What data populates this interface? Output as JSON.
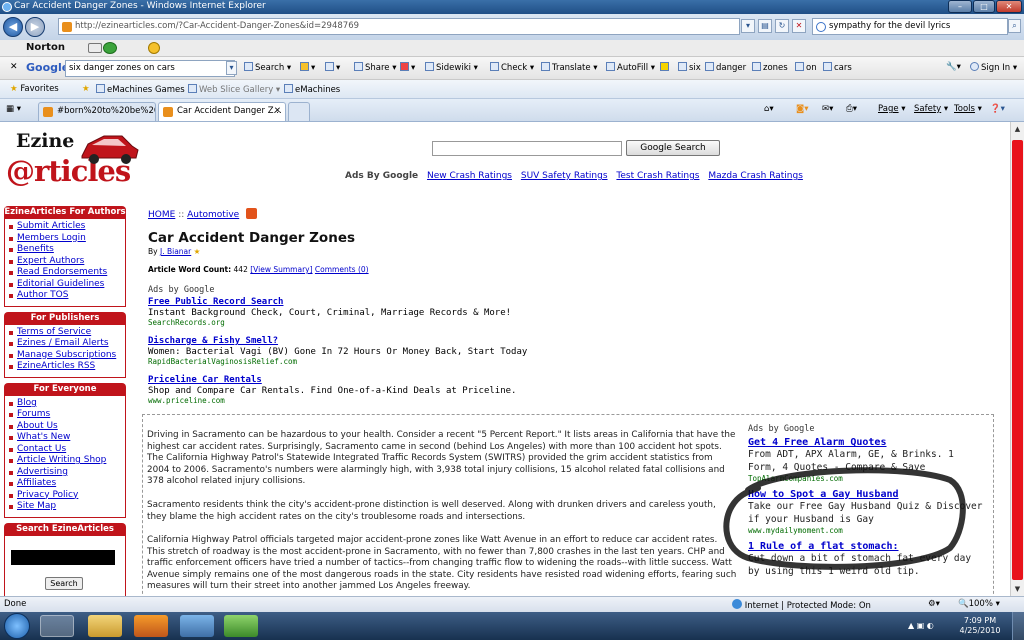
{
  "window": {
    "title": "Car Accident Danger Zones - Windows Internet Explorer"
  },
  "address_bar": {
    "url": "http://ezinearticles.com/?Car-Accident-Danger-Zones&id=2948769",
    "search_text": "sympathy for the devil lyrics"
  },
  "norton": {
    "label": "Norton"
  },
  "google_toolbar": {
    "logo": "Google",
    "query": "six danger zones on cars",
    "items": [
      "Search",
      "Share",
      "Sidewiki",
      "Check",
      "Translate",
      "AutoFill",
      "six",
      "danger",
      "zones",
      "on",
      "cars"
    ],
    "sign_in": "Sign In"
  },
  "favorites": {
    "label": "Favorites",
    "items": [
      "eMachines Games",
      "Web Slice Gallery",
      "eMachines"
    ]
  },
  "tabs": [
    {
      "label": "#born%20to%20be%20wil..."
    },
    {
      "label": "Car Accident Danger Z..."
    }
  ],
  "command_bar": {
    "page": "Page",
    "safety": "Safety",
    "tools": "Tools"
  },
  "site": {
    "logo_top": "Ezine",
    "logo_bottom": "@rticles",
    "search_button": "Google Search",
    "ads_by_google": "Ads By Google",
    "top_links": [
      "New Crash Ratings",
      "SUV Safety Ratings",
      "Test Crash Ratings",
      "Mazda Crash Ratings"
    ]
  },
  "sidebar": {
    "authors": {
      "title": "EzineArticles For Authors",
      "items": [
        "Submit Articles",
        "Members Login",
        "Benefits",
        "Expert Authors",
        "Read Endorsements",
        "Editorial Guidelines",
        "Author TOS"
      ]
    },
    "publishers": {
      "title": "For Publishers",
      "items": [
        "Terms of Service",
        "Ezines / Email Alerts",
        "Manage Subscriptions",
        "EzineArticles RSS"
      ]
    },
    "everyone": {
      "title": "For Everyone",
      "items": [
        "Blog",
        "Forums",
        "About Us",
        "What's New",
        "Contact Us",
        "Article Writing Shop",
        "Advertising",
        "Affiliates",
        "Privacy Policy",
        "Site Map"
      ]
    },
    "search": {
      "title": "Search EzineArticles",
      "button": "Search"
    }
  },
  "breadcrumb": {
    "home": "HOME",
    "sep": "::",
    "category": "Automotive"
  },
  "article": {
    "title": "Car Accident Danger Zones",
    "by": "By",
    "author": "J. Bianar",
    "word_count_label": "Article Word Count:",
    "word_count": "442",
    "view_summary": "[View Summary]",
    "comments": "Comments (0)",
    "paragraphs": [
      "Driving in Sacramento can be hazardous to your health. Consider a recent \"5 Percent Report.\" It lists areas in California that have the highest car accident rates. Surprisingly, Sacramento came in second (behind Los Angeles) with more than 100 accident hot spots. The California Highway Patrol's Statewide Integrated Traffic Records System (SWITRS) provided the grim accident statistics from 2004 to 2006. Sacramento's numbers were alarmingly high, with 3,938 total injury collisions, 15 alcohol related fatal collisions and 378 alcohol related injury collisions.",
      "Sacramento residents think the city's accident-prone distinction is well deserved. Along with drunken drivers and careless youth, they blame the high accident rates on the city's troublesome roads and intersections.",
      "California Highway Patrol officials targeted major accident-prone zones like Watt Avenue in an effort to reduce car accident rates. This stretch of roadway is the most accident-prone in Sacramento, with no fewer than 7,800 crashes in the last ten years. CHP and traffic enforcement officers have tried a number of tactics--from changing traffic flow to widening the roads--with little success. Watt Avenue simply remains one of the most dangerous roads in the state. City residents have resisted road widening efforts, fearing such measures will turn their street into another jammed Los Angeles freeway."
    ]
  },
  "top_ads": {
    "label": "Ads by Google",
    "items": [
      {
        "title": "Free Public Record Search",
        "desc": "Instant Background Check, Court, Criminal, Marriage Records & More!",
        "url": "SearchRecords.org"
      },
      {
        "title": "Discharge & Fishy Smell?",
        "desc": "Women: Bacterial Vagi (BV) Gone In 72 Hours Or Money Back, Start Today",
        "url": "RapidBacterialVaginosisRelief.com"
      },
      {
        "title": "Priceline Car Rentals",
        "desc": "Shop and Compare Car Rentals. Find One-of-a-Kind Deals at Priceline.",
        "url": "www.priceline.com"
      }
    ]
  },
  "right_ads": {
    "label": "Ads by Google",
    "items": [
      {
        "title": "Get 4 Free Alarm Quotes",
        "desc": "From ADT, APX Alarm, GE, & Brinks. 1 Form, 4 Quotes - Compare & Save",
        "url": "TopAlarmCompanies.com"
      },
      {
        "title": "How to Spot a Gay Husband",
        "desc": "Take our Free Gay Husband Quiz & Discover if your Husband is Gay",
        "url": "www.mydailymoment.com"
      },
      {
        "title": "1 Rule of a flat stomach:",
        "desc": "Cut down a bit of stomach fat every day by using this 1 weird old tip.",
        "url": ""
      }
    ]
  },
  "status": {
    "left": "Done",
    "zone": "Internet | Protected Mode: On",
    "zoom": "100%"
  },
  "clock": {
    "time": "7:09 PM",
    "date": "4/25/2010"
  }
}
